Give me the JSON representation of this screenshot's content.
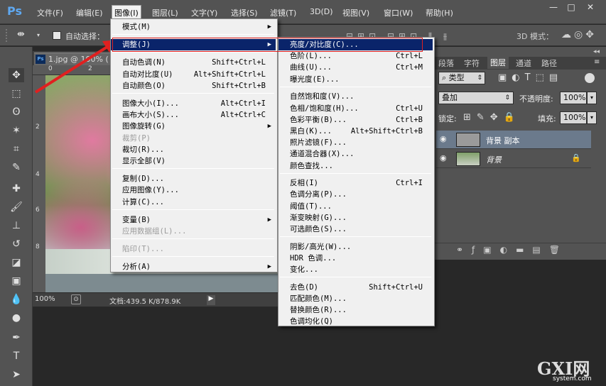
{
  "app": {
    "logo": "Ps"
  },
  "menubar": {
    "items": [
      "文件(F)",
      "编辑(E)",
      "图像(I)",
      "图层(L)",
      "文字(Y)",
      "选择(S)",
      "滤镜(T)",
      "3D(D)",
      "视图(V)",
      "窗口(W)",
      "帮助(H)"
    ],
    "active_index": 2,
    "window_controls": [
      "—",
      "□",
      "✕"
    ]
  },
  "optionsbar": {
    "auto_select_label": "自动选择：",
    "mode_3d_label": "3D 模式："
  },
  "document": {
    "tab_title": "1.jpg @ 100% (",
    "ruler_top": [
      "0",
      "2"
    ],
    "ruler_left": [
      "2",
      "4",
      "6",
      "8"
    ],
    "zoom": "100%",
    "doc_info": "文档:439.5 K/878.9K"
  },
  "panels": {
    "tabs": [
      "段落",
      "字符",
      "图层",
      "通道",
      "路径"
    ],
    "active_tab_index": 2,
    "filter_kind": "类型",
    "blend_mode": "叠加",
    "opacity_label": "不透明度:",
    "opacity_value": "100%",
    "lock_label": "锁定:",
    "fill_label": "填充:",
    "fill_value": "100%",
    "layers": [
      {
        "name": "背景 副本",
        "selected": true
      },
      {
        "name": "背景",
        "locked": true
      }
    ]
  },
  "image_menu": {
    "items": [
      {
        "label": "模式(M)",
        "shortcut": "",
        "submenu": true
      },
      {
        "sep": true
      },
      {
        "label": "调整(J)",
        "shortcut": "",
        "submenu": true,
        "highlight": true
      },
      {
        "sep": true
      },
      {
        "label": "自动色调(N)",
        "shortcut": "Shift+Ctrl+L"
      },
      {
        "label": "自动对比度(U)",
        "shortcut": "Alt+Shift+Ctrl+L"
      },
      {
        "label": "自动颜色(O)",
        "shortcut": "Shift+Ctrl+B"
      },
      {
        "sep": true
      },
      {
        "label": "图像大小(I)...",
        "shortcut": "Alt+Ctrl+I"
      },
      {
        "label": "画布大小(S)...",
        "shortcut": "Alt+Ctrl+C"
      },
      {
        "label": "图像旋转(G)",
        "shortcut": "",
        "submenu": true
      },
      {
        "label": "裁剪(P)",
        "shortcut": "",
        "disabled": true
      },
      {
        "label": "裁切(R)...",
        "shortcut": ""
      },
      {
        "label": "显示全部(V)",
        "shortcut": ""
      },
      {
        "sep": true
      },
      {
        "label": "复制(D)...",
        "shortcut": ""
      },
      {
        "label": "应用图像(Y)...",
        "shortcut": ""
      },
      {
        "label": "计算(C)...",
        "shortcut": ""
      },
      {
        "sep": true
      },
      {
        "label": "变量(B)",
        "shortcut": "",
        "submenu": true
      },
      {
        "label": "应用数据组(L)...",
        "shortcut": "",
        "disabled": true
      },
      {
        "sep": true
      },
      {
        "label": "陷印(T)...",
        "shortcut": "",
        "disabled": true
      },
      {
        "sep": true
      },
      {
        "label": "分析(A)",
        "shortcut": "",
        "submenu": true
      }
    ]
  },
  "adjust_menu": {
    "items": [
      {
        "label": "亮度/对比度(C)...",
        "shortcut": "",
        "highlight": true
      },
      {
        "label": "色阶(L)...",
        "shortcut": "Ctrl+L"
      },
      {
        "label": "曲线(U)...",
        "shortcut": "Ctrl+M"
      },
      {
        "label": "曝光度(E)...",
        "shortcut": ""
      },
      {
        "sep": true
      },
      {
        "label": "自然饱和度(V)...",
        "shortcut": ""
      },
      {
        "label": "色相/饱和度(H)...",
        "shortcut": "Ctrl+U"
      },
      {
        "label": "色彩平衡(B)...",
        "shortcut": "Ctrl+B"
      },
      {
        "label": "黑白(K)...",
        "shortcut": "Alt+Shift+Ctrl+B"
      },
      {
        "label": "照片滤镜(F)...",
        "shortcut": ""
      },
      {
        "label": "通道混合器(X)...",
        "shortcut": ""
      },
      {
        "label": "颜色查找...",
        "shortcut": ""
      },
      {
        "sep": true
      },
      {
        "label": "反相(I)",
        "shortcut": "Ctrl+I"
      },
      {
        "label": "色调分离(P)...",
        "shortcut": ""
      },
      {
        "label": "阈值(T)...",
        "shortcut": ""
      },
      {
        "label": "渐变映射(G)...",
        "shortcut": ""
      },
      {
        "label": "可选颜色(S)...",
        "shortcut": ""
      },
      {
        "sep": true
      },
      {
        "label": "阴影/高光(W)...",
        "shortcut": ""
      },
      {
        "label": "HDR 色调...",
        "shortcut": ""
      },
      {
        "label": "变化...",
        "shortcut": ""
      },
      {
        "sep": true
      },
      {
        "label": "去色(D)",
        "shortcut": "Shift+Ctrl+U"
      },
      {
        "label": "匹配颜色(M)...",
        "shortcut": ""
      },
      {
        "label": "替换颜色(R)...",
        "shortcut": ""
      },
      {
        "label": "色调均化(Q)",
        "shortcut": ""
      }
    ]
  },
  "watermark": {
    "logo": "GXI网",
    "site": "system.com"
  },
  "colors": {
    "accent_highlight": "#0a246a",
    "arrow": "#e02020",
    "panel_bg": "#535353"
  }
}
